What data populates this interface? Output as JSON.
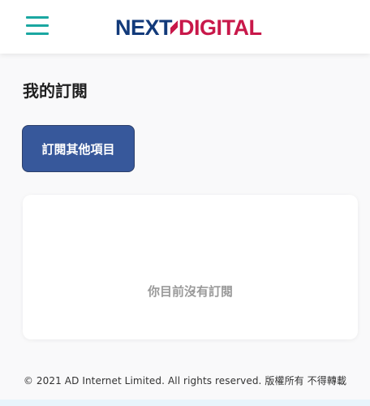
{
  "header": {
    "logo": {
      "part1": "NEXT",
      "part2": "DIGITAL"
    }
  },
  "page": {
    "title": "我的訂閱",
    "subscribe_button": "訂閱其他項目",
    "empty_message": "你目前沒有訂閱"
  },
  "footer": {
    "copyright": "© 2021 AD Internet Limited. All rights reserved. 版權所有 不得轉載"
  },
  "colors": {
    "menu_icon": "#1aa7a1",
    "logo_blue": "#123a7a",
    "logo_red": "#c8184a",
    "button_bg": "#37589b"
  },
  "icons": {
    "menu": "hamburger-menu-icon"
  }
}
